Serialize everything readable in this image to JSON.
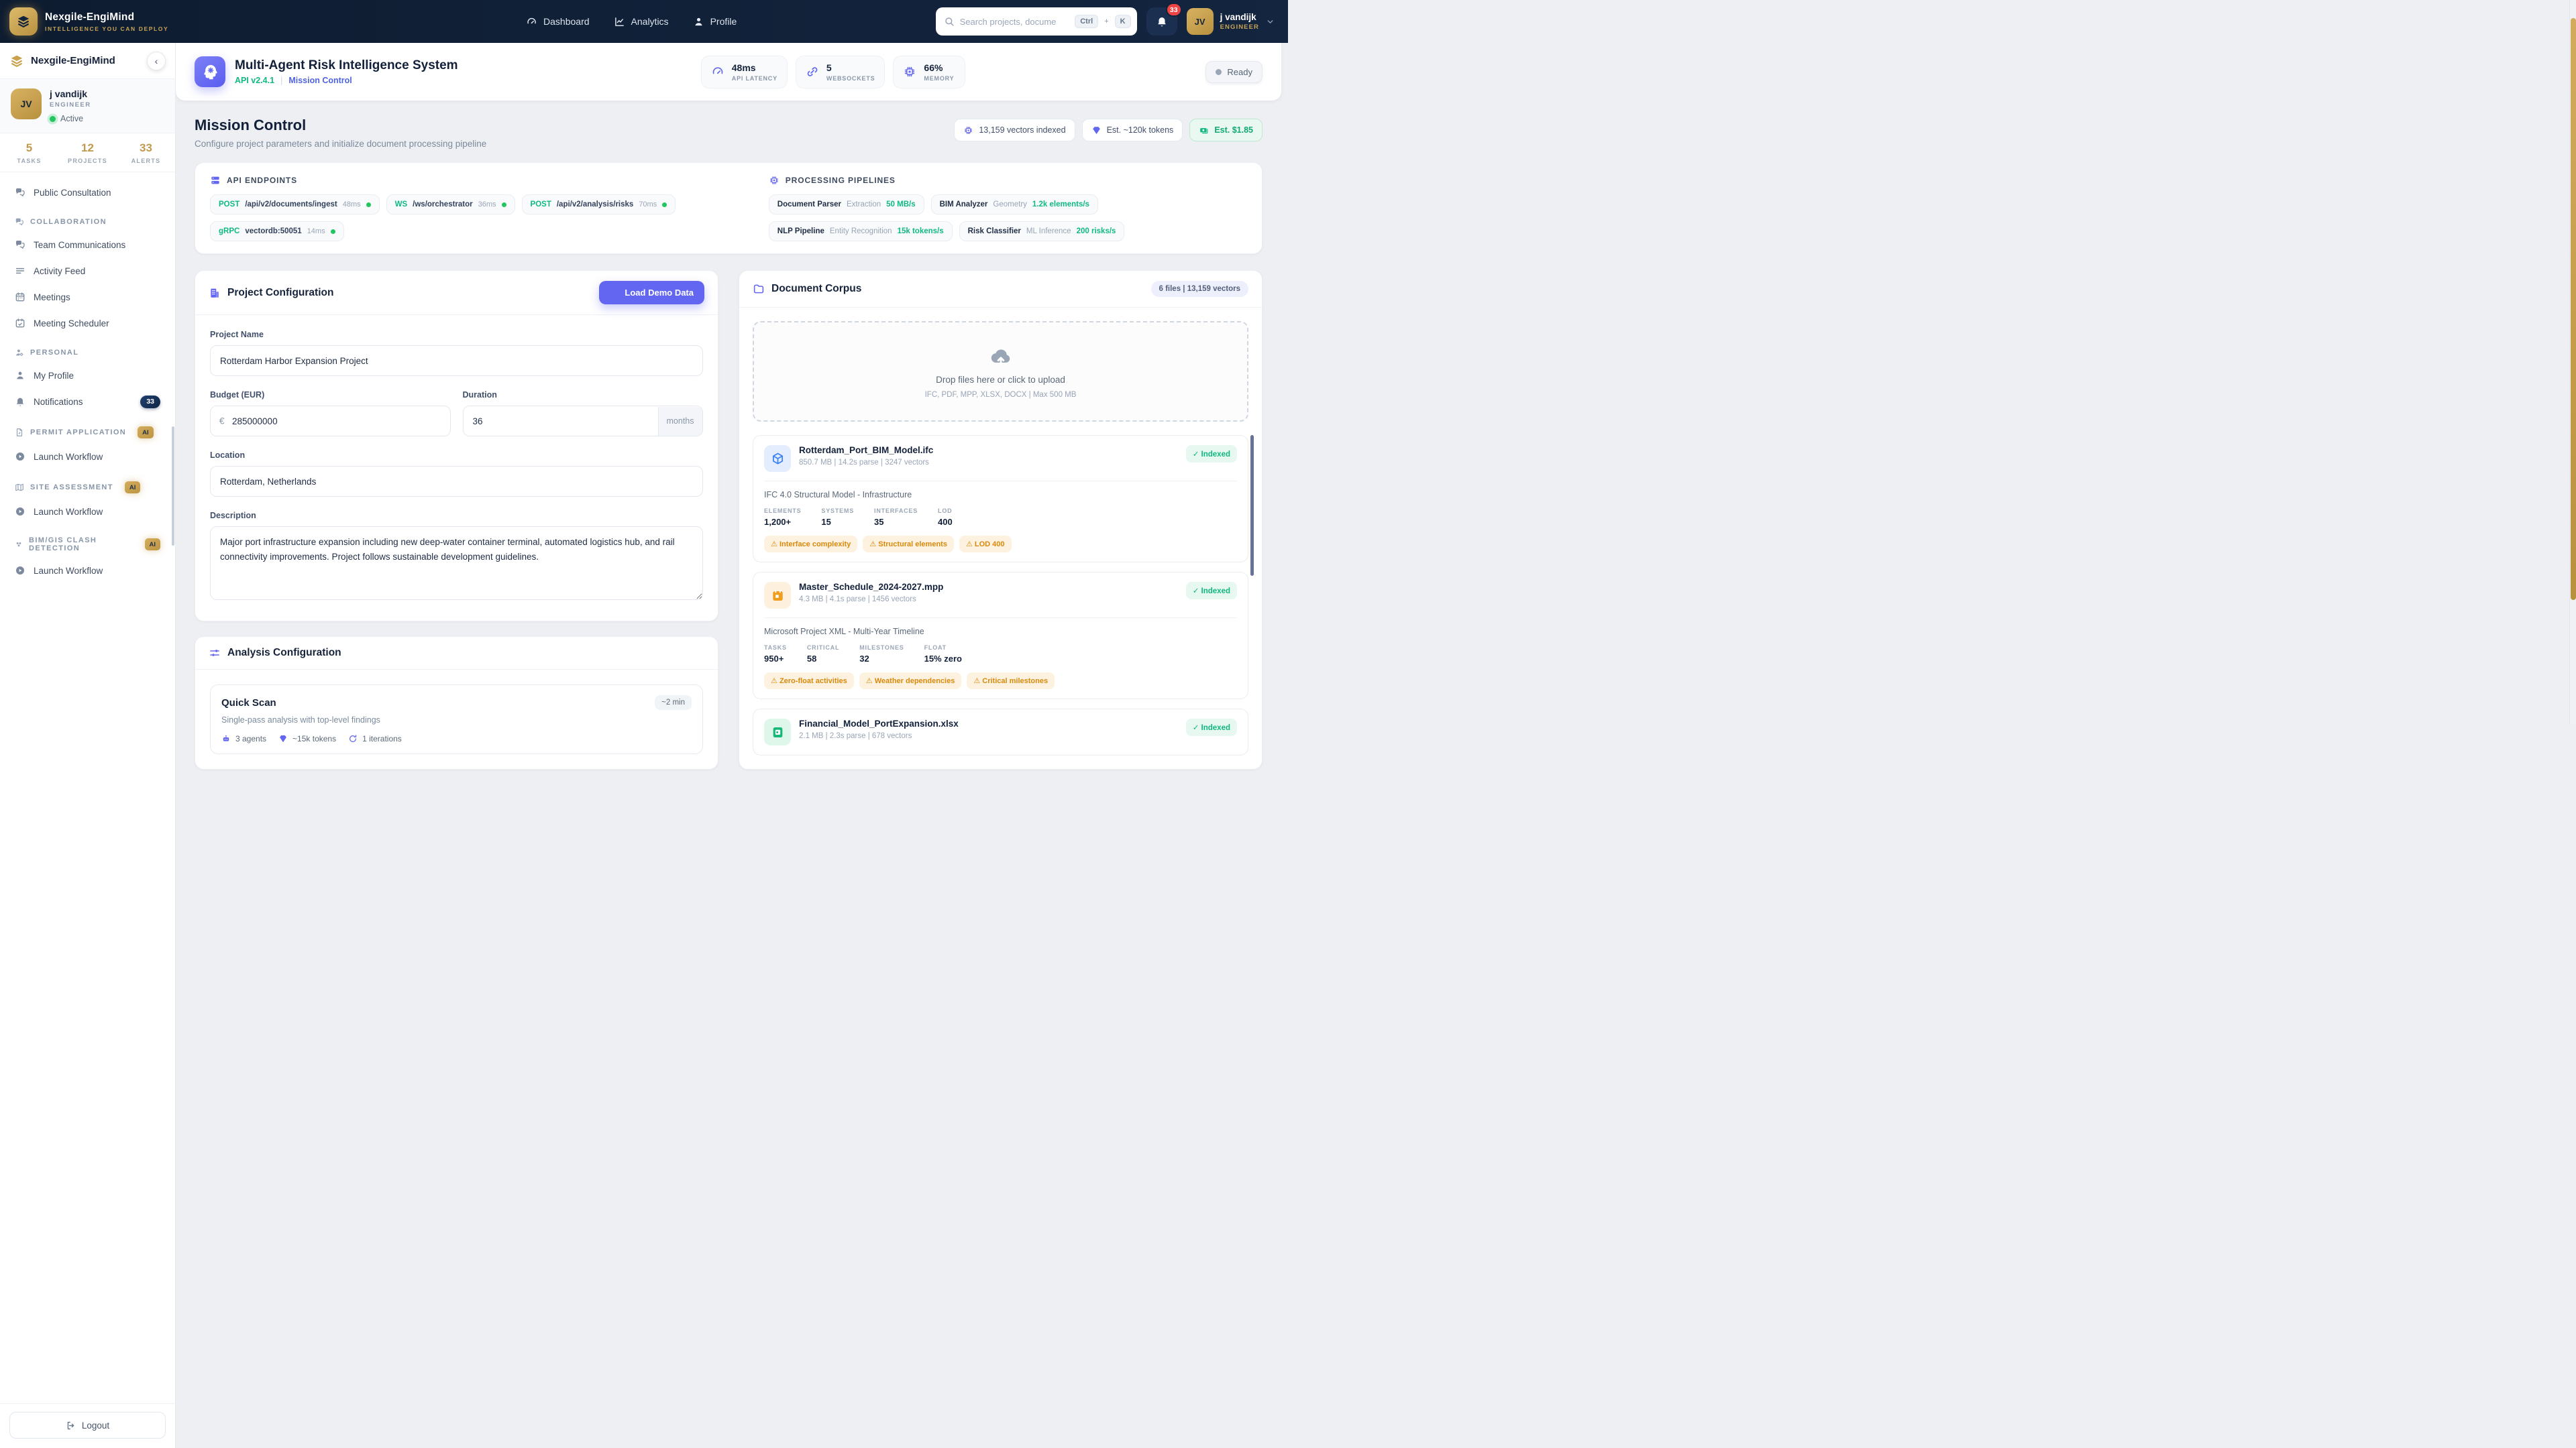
{
  "colors": {
    "brand_gold": "#c9a24b",
    "navy": "#0f1d33",
    "accent_purple": "#6366f1",
    "green": "#10b981",
    "alert_red": "#ef4444",
    "warning_orange": "#d9890b"
  },
  "navbar": {
    "brand_title": "Nexgile-EngiMind",
    "brand_tagline": "INTELLIGENCE YOU CAN DEPLOY",
    "items": [
      {
        "label": "Dashboard"
      },
      {
        "label": "Analytics"
      },
      {
        "label": "Profile"
      }
    ],
    "search": {
      "placeholder": "Search projects, docume",
      "key1": "Ctrl",
      "plus": "+",
      "key2": "K"
    },
    "notification_count": "33",
    "user": {
      "initials": "JV",
      "name": "j vandijk",
      "role": "ENGINEER"
    }
  },
  "sidebar": {
    "brand": "Nexgile-EngiMind",
    "collapse_glyph": "‹",
    "user": {
      "initials": "JV",
      "name": "j vandijk",
      "role": "ENGINEER",
      "status": "Active"
    },
    "stats": [
      {
        "value": "5",
        "label": "TASKS"
      },
      {
        "value": "12",
        "label": "PROJECTS"
      },
      {
        "value": "33",
        "label": "ALERTS"
      }
    ],
    "top_item": "Public Consultation",
    "sections": [
      {
        "label": "COLLABORATION",
        "items": [
          "Team Communications",
          "Activity Feed",
          "Meetings",
          "Meeting Scheduler"
        ]
      },
      {
        "label": "PERSONAL",
        "items": [
          "My Profile",
          "Notifications"
        ],
        "notification_badge": "33"
      },
      {
        "label": "PERMIT APPLICATION",
        "ai_badge": "AI",
        "items": [
          "Launch Workflow"
        ]
      },
      {
        "label": "SITE ASSESSMENT",
        "ai_badge": "AI",
        "items": [
          "Launch Workflow"
        ]
      },
      {
        "label": "BIM/GIS CLASH DETECTION",
        "ai_badge": "AI",
        "items": [
          "Launch Workflow"
        ]
      }
    ],
    "logout": "Logout"
  },
  "appbar": {
    "title": "Multi-Agent Risk Intelligence System",
    "api_version": "API v2.4.1",
    "divider": "|",
    "context": "Mission Control",
    "metrics": [
      {
        "value": "48ms",
        "label": "API LATENCY"
      },
      {
        "value": "5",
        "label": "WEBSOCKETS"
      },
      {
        "value": "66%",
        "label": "MEMORY"
      }
    ],
    "status": "Ready"
  },
  "mission": {
    "title": "Mission Control",
    "subtitle": "Configure project parameters and initialize document processing pipeline",
    "chips": [
      {
        "label": "13,159 vectors indexed"
      },
      {
        "label": "Est. ~120k tokens"
      },
      {
        "label": "Est. $1.85"
      }
    ]
  },
  "endpoints": {
    "title": "API ENDPOINTS",
    "items": [
      {
        "method": "POST",
        "path": "/api/v2/documents/ingest",
        "latency": "48ms"
      },
      {
        "method": "WS",
        "path": "/ws/orchestrator",
        "latency": "36ms"
      },
      {
        "method": "POST",
        "path": "/api/v2/analysis/risks",
        "latency": "70ms"
      },
      {
        "method": "gRPC",
        "path": "vectordb:50051",
        "latency": "14ms"
      }
    ]
  },
  "pipelines": {
    "title": "PROCESSING PIPELINES",
    "items": [
      {
        "name": "Document Parser",
        "type": "Extraction",
        "rate": "50 MB/s"
      },
      {
        "name": "BIM Analyzer",
        "type": "Geometry",
        "rate": "1.2k elements/s"
      },
      {
        "name": "NLP Pipeline",
        "type": "Entity Recognition",
        "rate": "15k tokens/s"
      },
      {
        "name": "Risk Classifier",
        "type": "ML Inference",
        "rate": "200 risks/s"
      }
    ]
  },
  "project": {
    "title": "Project Configuration",
    "demo_button": "Load Demo Data",
    "name_label": "Project Name",
    "name_value": "Rotterdam Harbor Expansion Project",
    "budget_label": "Budget (EUR)",
    "budget_prefix": "€",
    "budget_value": "285000000",
    "duration_label": "Duration",
    "duration_value": "36",
    "duration_suffix": "months",
    "location_label": "Location",
    "location_value": "Rotterdam, Netherlands",
    "description_label": "Description",
    "description_value": "Major port infrastructure expansion including new deep-water container terminal, automated logistics hub, and rail connectivity improvements. Project follows sustainable development guidelines."
  },
  "analysis": {
    "title": "Analysis Configuration",
    "mode": {
      "name": "Quick Scan",
      "duration": "~2 min",
      "description": "Single-pass analysis with top-level findings",
      "agents": "3 agents",
      "tokens": "~15k tokens",
      "iterations": "1 iterations"
    }
  },
  "corpus": {
    "title": "Document Corpus",
    "badge": "6 files | 13,159 vectors",
    "drop_line1": "Drop files here or click to upload",
    "drop_line2": "IFC, PDF, MPP, XLSX, DOCX | Max 500 MB",
    "check": "✓",
    "warn": "⚠",
    "files": [
      {
        "name": "Rotterdam_Port_BIM_Model.ifc",
        "meta": "850.7 MB | 14.2s parse | 3247 vectors",
        "status": "Indexed",
        "subtitle": "IFC 4.0 Structural Model - Infrastructure",
        "stats": [
          {
            "label": "ELEMENTS",
            "value": "1,200+"
          },
          {
            "label": "SYSTEMS",
            "value": "15"
          },
          {
            "label": "INTERFACES",
            "value": "35"
          },
          {
            "label": "LOD",
            "value": "400"
          }
        ],
        "warnings": [
          "Interface complexity",
          "Structural elements",
          "LOD 400"
        ]
      },
      {
        "name": "Master_Schedule_2024-2027.mpp",
        "meta": "4.3 MB | 4.1s parse | 1456 vectors",
        "status": "Indexed",
        "subtitle": "Microsoft Project XML - Multi-Year Timeline",
        "stats": [
          {
            "label": "TASKS",
            "value": "950+"
          },
          {
            "label": "CRITICAL",
            "value": "58"
          },
          {
            "label": "MILESTONES",
            "value": "32"
          },
          {
            "label": "FLOAT",
            "value": "15% zero"
          }
        ],
        "warnings": [
          "Zero-float activities",
          "Weather dependencies",
          "Critical milestones"
        ]
      },
      {
        "name": "Financial_Model_PortExpansion.xlsx",
        "meta": "2.1 MB | 2.3s parse | 678 vectors",
        "status": "Indexed"
      }
    ]
  }
}
